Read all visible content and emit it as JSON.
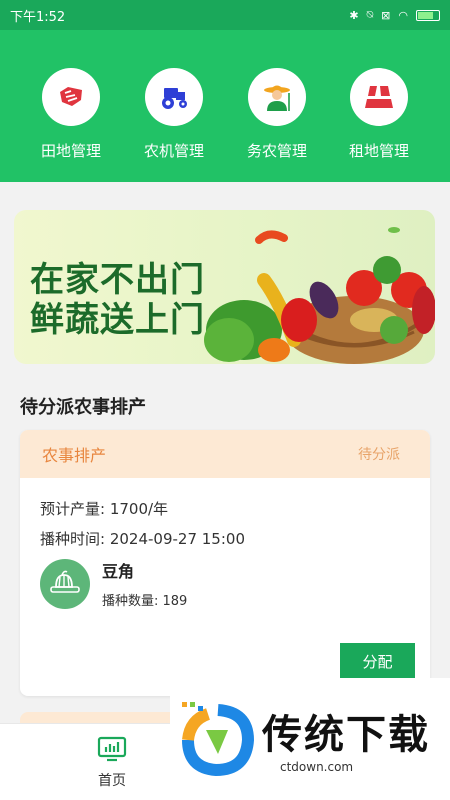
{
  "status": {
    "time": "下午1:52"
  },
  "nav": [
    {
      "label": "田地管理",
      "icon": "field-icon"
    },
    {
      "label": "农机管理",
      "icon": "tractor-icon"
    },
    {
      "label": "务农管理",
      "icon": "farmer-icon"
    },
    {
      "label": "租地管理",
      "icon": "rent-land-icon"
    }
  ],
  "banner": {
    "line1": "在家不出门",
    "line2": "鲜蔬送上门"
  },
  "section": {
    "title": "待分派农事排产"
  },
  "card": {
    "title": "农事排产",
    "status": "待分派",
    "yield_label": "预计产量: 1700/年",
    "sow_time_label": "播种时间: 2024-09-27 15:00",
    "crop_name": "豆角",
    "sow_count_label": "播种数量: 189",
    "assign_button": "分配"
  },
  "tabbar": {
    "home": "首页"
  },
  "watermark": {
    "brand": "传统下载",
    "url": "ctdown.com"
  },
  "colors": {
    "primary": "#21c266",
    "status_bar": "#1aa85a",
    "card_header_bg": "#fde9d4",
    "card_header_text": "#e8863f"
  }
}
